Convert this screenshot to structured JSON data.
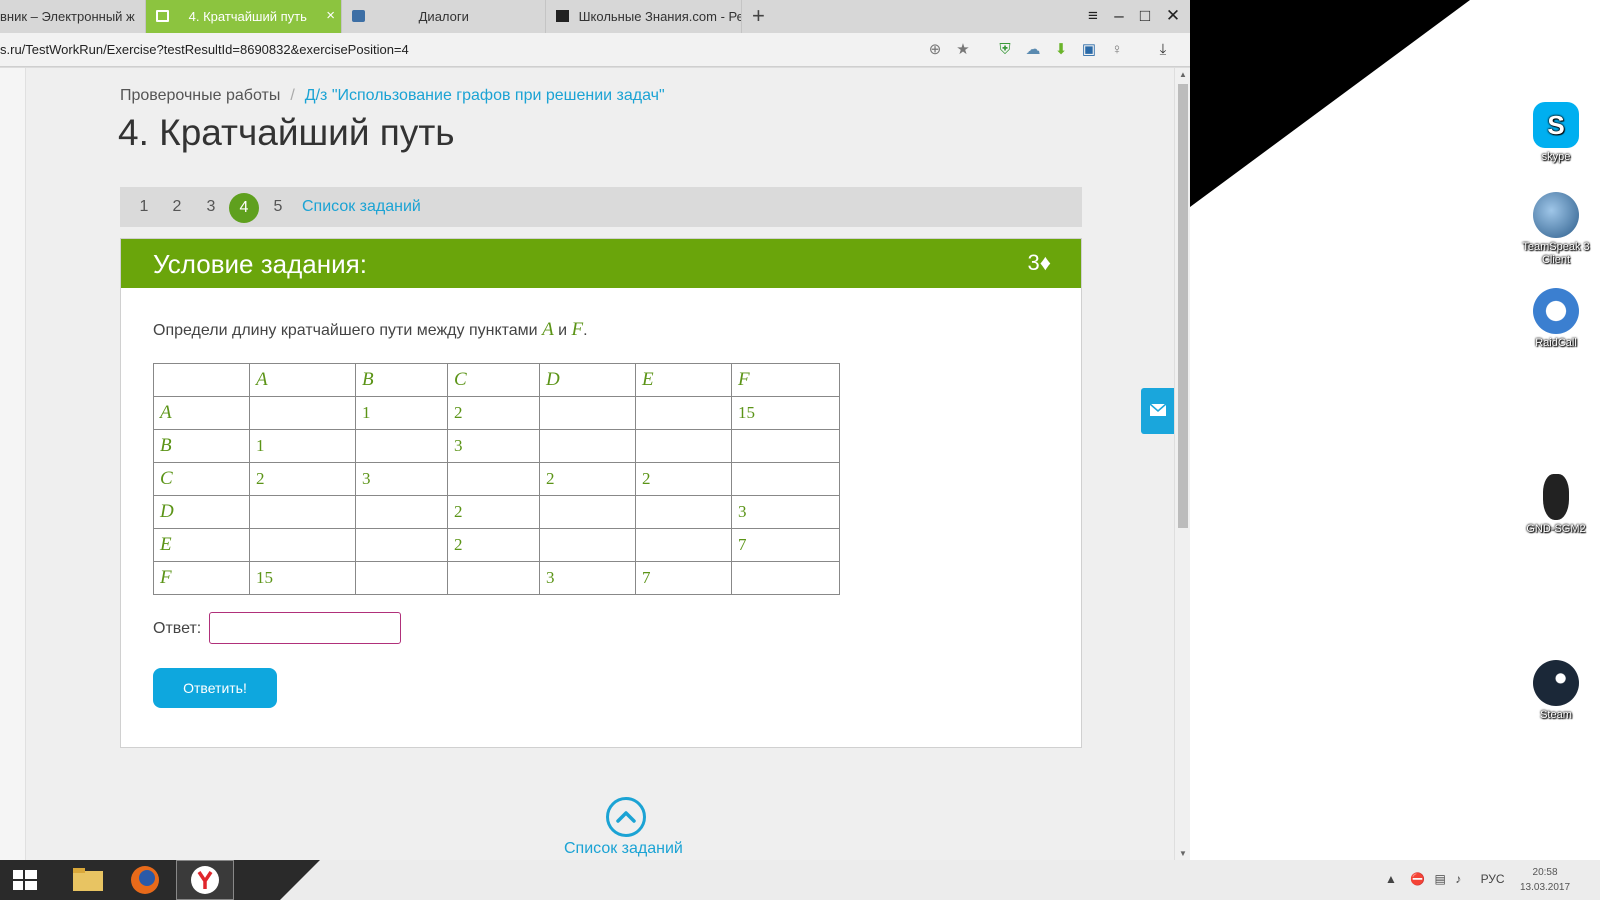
{
  "browser": {
    "tabs": [
      {
        "label": "вник – Электронный ж",
        "active": false
      },
      {
        "label": "4. Кратчайший путь",
        "active": true
      },
      {
        "label": "Диалоги",
        "active": false
      },
      {
        "label": "Школьные Знания.com - Ре",
        "active": false
      }
    ],
    "tab_close": "×",
    "new_tab": "+",
    "url": "s.ru/TestWorkRun/Exercise?testResultId=8690832&exercisePosition=4"
  },
  "page": {
    "breadcrumb": {
      "root": "Проверочные работы",
      "separator": "/",
      "current": "Д/з \"Использование графов при решении задач\""
    },
    "title": "4. Кратчайший путь",
    "task_nav": {
      "numbers": [
        "1",
        "2",
        "3",
        "4",
        "5"
      ],
      "active": "4",
      "list_link": "Список заданий"
    },
    "card": {
      "header": "Условие задания:",
      "points": "3♦",
      "question_prefix": "Определи длину кратчайшего пути между пунктами",
      "var_a": "A",
      "conj": "и",
      "var_f": "F",
      "period": ".",
      "matrix": {
        "headers": [
          "",
          "A",
          "B",
          "C",
          "D",
          "E",
          "F"
        ],
        "rows": [
          [
            "A",
            "",
            "1",
            "2",
            "",
            "",
            "15"
          ],
          [
            "B",
            "1",
            "",
            "3",
            "",
            "",
            ""
          ],
          [
            "C",
            "2",
            "3",
            "",
            "2",
            "2",
            ""
          ],
          [
            "D",
            "",
            "",
            "2",
            "",
            "",
            "3"
          ],
          [
            "E",
            "",
            "",
            "2",
            "",
            "",
            "7"
          ],
          [
            "F",
            "15",
            "",
            "",
            "3",
            "7",
            ""
          ]
        ]
      },
      "answer_label": "Ответ:",
      "answer_value": "",
      "submit_label": "Ответить!"
    },
    "bottom_link": "Список заданий"
  },
  "desktop": {
    "icons": [
      {
        "name": "skype-icon",
        "label": "skype",
        "color": "#00aff0"
      },
      {
        "name": "teamspeak-icon",
        "label": "TeamSpeak 3 Client",
        "color": "#2b5c8a"
      },
      {
        "name": "raidcall-icon",
        "label": "RaidCall",
        "color": "#3b7fd0"
      },
      {
        "name": "gnd-sgm2-icon",
        "label": "GND-SGM2",
        "color": "#222222"
      },
      {
        "name": "steam-icon",
        "label": "Steam",
        "color": "#1b2838"
      }
    ]
  },
  "taskbar": {
    "language": "РУС",
    "time": "20:58",
    "date": "13.03.2017"
  },
  "colors": {
    "accent_green": "#6aa50b",
    "tab_green": "#8cc43f",
    "link_blue": "#1ba3d4",
    "button_blue": "#0ea7de"
  }
}
